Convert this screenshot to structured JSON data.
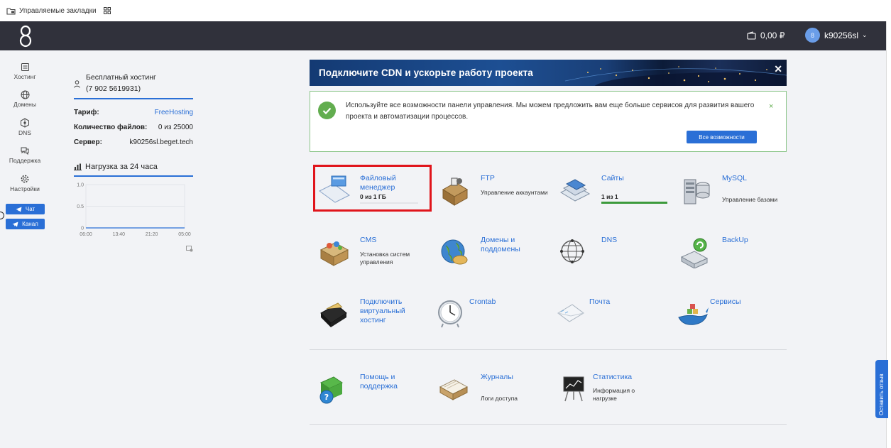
{
  "bookmarks": {
    "managed_label": "Управляемые закладки"
  },
  "topnav": {
    "balance": "0,00 ₽",
    "username": "k90256sl",
    "avatar_letter": "8"
  },
  "rail": {
    "items": [
      {
        "label": "Хостинг",
        "icon": "server-icon"
      },
      {
        "label": "Домены",
        "icon": "globe-icon"
      },
      {
        "label": "DNS",
        "icon": "network-icon"
      },
      {
        "label": "Поддержка",
        "icon": "chat-icon"
      },
      {
        "label": "Настройки",
        "icon": "gear-icon"
      }
    ],
    "chat_button": "Чат",
    "channel_button": "Канал"
  },
  "hosting": {
    "plan_name": "Бесплатный хостинг",
    "phone": "(7 902 5619931)",
    "rows": [
      {
        "label": "Тариф:",
        "value": "FreeHosting"
      },
      {
        "label": "Количество файлов:",
        "value": "0 из 25000"
      },
      {
        "label": "Сервер:",
        "value": "k90256sl.beget.tech"
      }
    ]
  },
  "load": {
    "title": "Нагрузка за 24 часа"
  },
  "chart_data": {
    "type": "line",
    "title": "Нагрузка за 24 часа",
    "x": [
      "06:00",
      "13:40",
      "21:20",
      "05:00"
    ],
    "y_ticks": [
      "0",
      "0.5",
      "1.0"
    ],
    "ylim": [
      0,
      1.0
    ],
    "series": [
      {
        "values": [
          0,
          0,
          0,
          0
        ]
      }
    ],
    "grid": true
  },
  "banner": {
    "text": "Подключите CDN и ускорьте работу проекта",
    "close": "✕"
  },
  "notice": {
    "message": "Используйте все возможности панели управления. Мы можем предложить вам еще больше сервисов для развития вашего проекта и автоматизации процессов.",
    "button": "Все возможности",
    "close": "×"
  },
  "services": [
    {
      "name": "Файловый менеджер",
      "count": "0 из 1 ГБ",
      "progress": 0,
      "icon": "file-manager-icon"
    },
    {
      "name": "FTP",
      "sub": "Управление аккаунтами",
      "icon": "ftp-icon"
    },
    {
      "name": "Сайты",
      "count": "1 из 1",
      "progress": 1,
      "icon": "sites-icon"
    },
    {
      "name": "MySQL",
      "sub": "Управление базами",
      "icon": "mysql-icon"
    },
    {
      "name": "CMS",
      "sub": "Установка систем управления",
      "icon": "cms-icon"
    },
    {
      "name": "Домены и поддомены",
      "icon": "domains-icon"
    },
    {
      "name": "DNS",
      "icon": "dns-icon"
    },
    {
      "name": "BackUp",
      "icon": "backup-icon"
    },
    {
      "name": "Подключить виртуальный хостинг",
      "icon": "wallet-icon"
    },
    {
      "name": "Crontab",
      "icon": "clock-icon"
    },
    {
      "name": "Почта",
      "icon": "mail-icon"
    },
    {
      "name": "Сервисы",
      "icon": "whale-icon"
    },
    {
      "name": "Помощь и поддержка",
      "icon": "help-icon"
    },
    {
      "name": "Журналы",
      "sub": "Логи доступа",
      "icon": "logs-icon"
    },
    {
      "name": "Статистика",
      "sub": "Информация о нагрузке",
      "icon": "stats-icon"
    }
  ],
  "feedback": {
    "label": "Оставить отзыв"
  },
  "colors": {
    "accent": "#2a6fd6",
    "nav": "#30313b",
    "success": "#62ad4f",
    "highlight": "#e0141b"
  }
}
